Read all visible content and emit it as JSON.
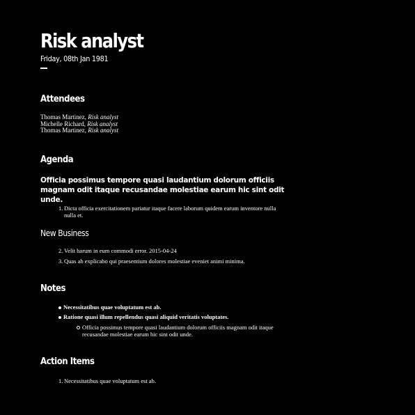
{
  "meeting": {
    "title": "Risk analyst",
    "date": "Friday, 08th Jan 1981"
  },
  "attendees": {
    "heading": "Attendees",
    "list": [
      {
        "name": "Thomas Martinez",
        "separator": ", ",
        "role": "Risk analyst"
      },
      {
        "name": "Michelle Richard",
        "separator": ", ",
        "role": "Risk analyst"
      },
      {
        "name": "Thomas Martinez",
        "separator": ", ",
        "role": "Risk analyst"
      }
    ]
  },
  "agenda": {
    "heading": "Agenda",
    "lead": "Officia possimus tempore quasi laudantium dolorum officiis magnam odit itaque recusandae molestiae earum hic sint odit unde.",
    "items": [
      {
        "num": "1.",
        "text": "Dicta officia exercitationem pariatur itaque facere laborum quidem earum inventore nulla nulla et."
      }
    ],
    "subheading": "New Business",
    "new_business": [
      {
        "num": "2.",
        "text": "Velit harum in eum commodi error. 2015-04-24"
      },
      {
        "num": "3.",
        "text": "Quas ab explicabo qui praesentium dolores molestiae eveniet animi minima."
      }
    ]
  },
  "notes": {
    "heading": "Notes",
    "items": [
      {
        "text": "Necessitatibus quae voluptatum est ab."
      },
      {
        "text": "Ratione quasi illum repellendus quasi aliquid veritatis voluptates."
      }
    ],
    "subitem": "Officia possimus tempore quasi laudantium dolorum officiis magnam odit itaque recusandae molestiae earum hic sint odit unde."
  },
  "action_items": {
    "heading": "Action Items",
    "items": [
      {
        "num": "1.",
        "text": "Necessitatibus quae voluptatum est ab."
      }
    ]
  }
}
